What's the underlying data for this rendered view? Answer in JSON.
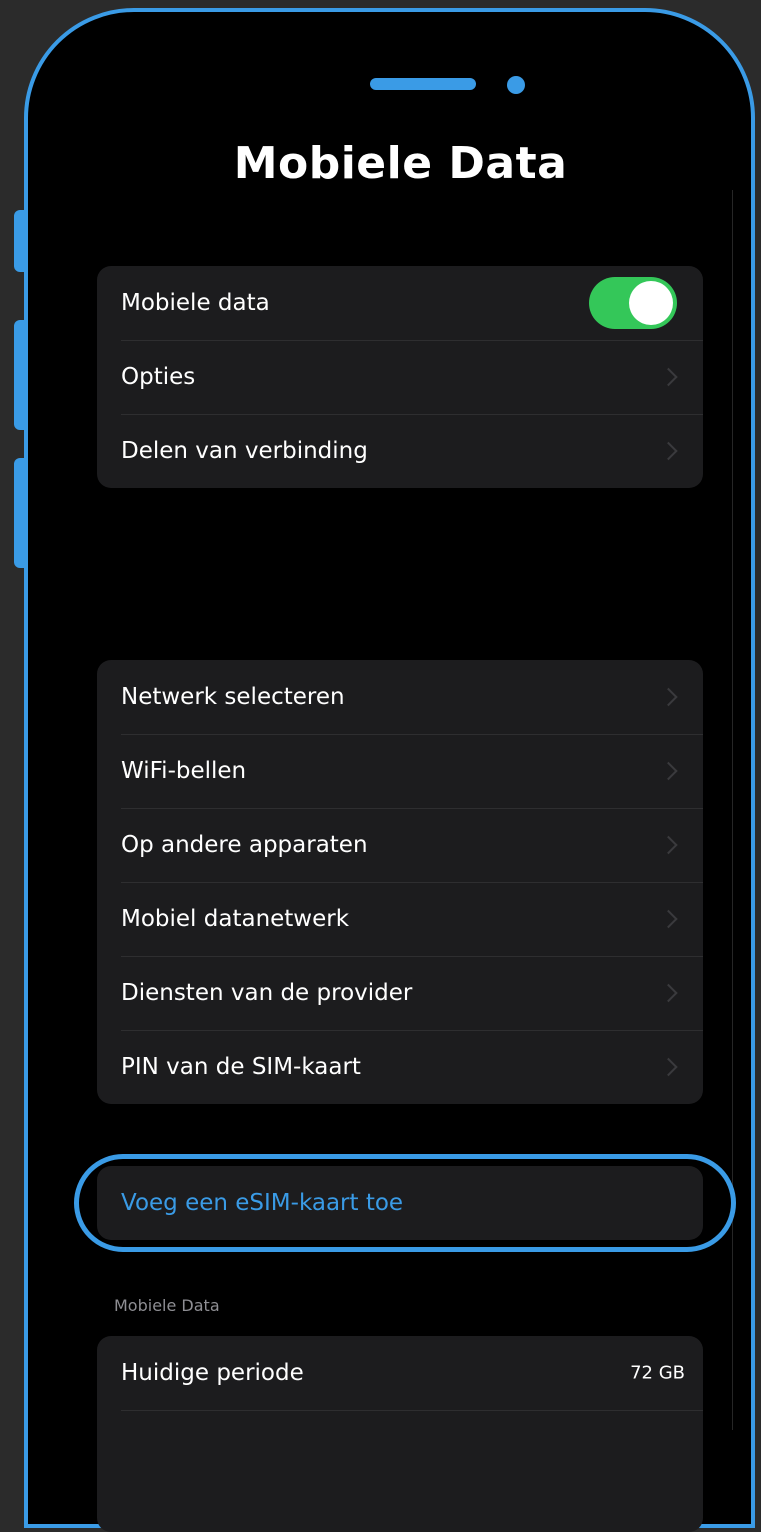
{
  "header": {
    "title": "Mobiele Data"
  },
  "group1": {
    "items": [
      {
        "label": "Mobiele data",
        "control": "toggle",
        "toggle_on": true
      },
      {
        "label": "Opties",
        "control": "chevron"
      },
      {
        "label": "Delen van verbinding",
        "control": "chevron"
      }
    ]
  },
  "group2": {
    "items": [
      {
        "label": "Netwerk selecteren"
      },
      {
        "label": "WiFi-bellen"
      },
      {
        "label": "Op andere apparaten"
      },
      {
        "label": "Mobiel datanetwerk"
      },
      {
        "label": "Diensten van de provider"
      },
      {
        "label": "PIN van de SIM-kaart"
      }
    ]
  },
  "esim": {
    "label": "Voeg een eSIM-kaart toe"
  },
  "usage": {
    "section_header": "Mobiele Data",
    "items": [
      {
        "label": "Huidige periode",
        "value": "72 GB"
      }
    ]
  },
  "icons": {
    "chevron": "chevron-right-icon",
    "toggle": "toggle-switch"
  },
  "colors": {
    "accent": "#3a9be6",
    "toggle_on": "#34c759",
    "background": "#000000",
    "cell": "#1c1c1e",
    "frame_bg": "#2b2b2b"
  }
}
